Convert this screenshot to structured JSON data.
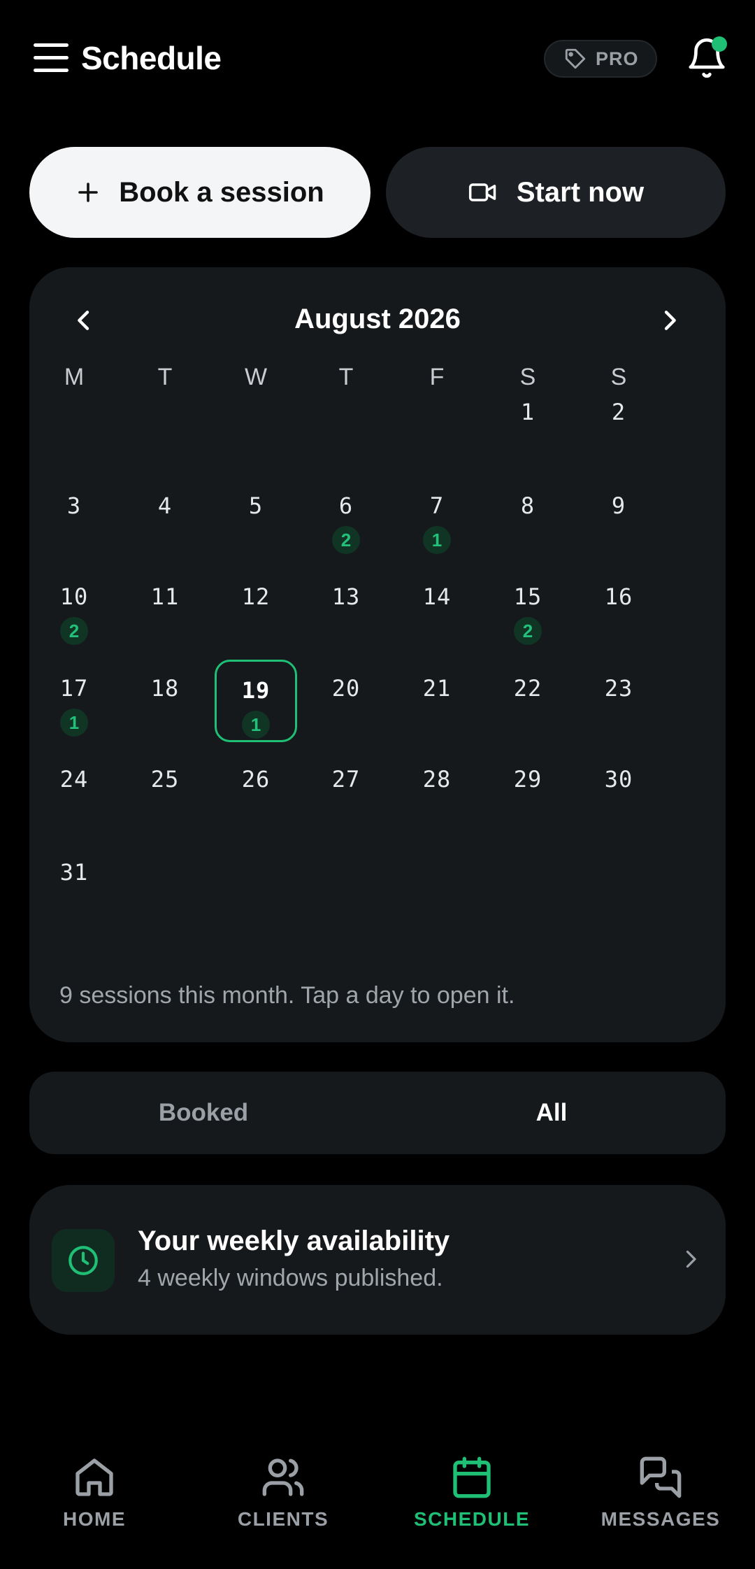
{
  "header": {
    "title": "Schedule",
    "pro_label": "PRO",
    "has_notification": true
  },
  "actions": {
    "book_label": "Book a session",
    "start_label": "Start now"
  },
  "calendar": {
    "month_label": "August 2026",
    "weekdays": [
      "M",
      "T",
      "W",
      "T",
      "F",
      "S",
      "S"
    ],
    "first_weekday_index": 5,
    "days_in_month": 31,
    "selected_day": 19,
    "session_counts": {
      "6": 2,
      "7": 1,
      "10": 2,
      "15": 2,
      "17": 1,
      "19": 1
    },
    "footer": "9 sessions this month. Tap a day to open it."
  },
  "filter": {
    "booked_label": "Booked",
    "all_label": "All",
    "active": "All"
  },
  "availability": {
    "title": "Your weekly availability",
    "subtitle": "4 weekly windows published."
  },
  "nav": {
    "items": [
      {
        "label": "HOME",
        "icon": "home-icon"
      },
      {
        "label": "CLIENTS",
        "icon": "clients-icon"
      },
      {
        "label": "SCHEDULE",
        "icon": "calendar-icon"
      },
      {
        "label": "MESSAGES",
        "icon": "messages-icon"
      }
    ],
    "active": "SCHEDULE"
  },
  "colors": {
    "accent": "#1fbf76",
    "background": "#000000",
    "card": "#16191c"
  }
}
